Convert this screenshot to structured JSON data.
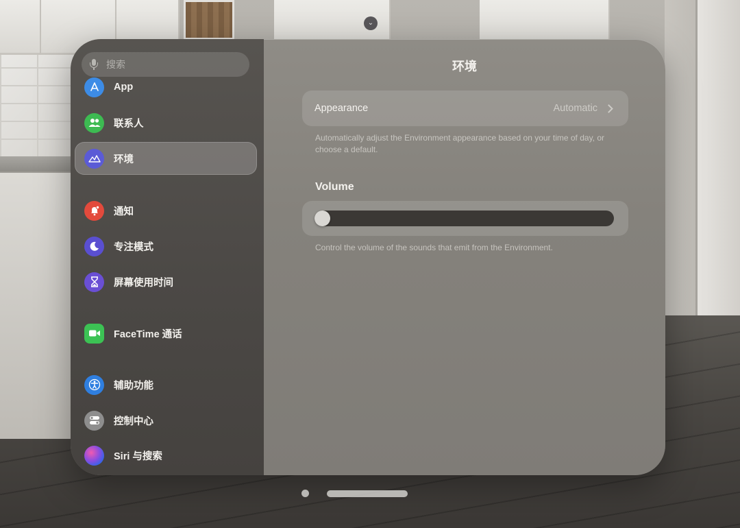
{
  "search": {
    "placeholder": "搜索",
    "icon": "mic-icon"
  },
  "sidebar": {
    "items": [
      {
        "label": "App",
        "icon": "app-store-icon",
        "color": "#3d8ce6"
      },
      {
        "label": "联系人",
        "icon": "contacts-icon",
        "color": "#3dbb52"
      },
      {
        "label": "环境",
        "icon": "environment-icon",
        "color": "#5b5bd6",
        "selected": true
      },
      {
        "label": "通知",
        "icon": "notifications-icon",
        "color": "#e34a3c"
      },
      {
        "label": "专注模式",
        "icon": "focus-moon-icon",
        "color": "#5a4fd1"
      },
      {
        "label": "屏幕使用时间",
        "icon": "hourglass-icon",
        "color": "#6a4fd4"
      },
      {
        "label": "FaceTime 通话",
        "icon": "facetime-icon",
        "color": "#3cc254"
      },
      {
        "label": "辅助功能",
        "icon": "accessibility-icon",
        "color": "#2f7fe0"
      },
      {
        "label": "控制中心",
        "icon": "control-center-icon",
        "color": "#8e8e8e"
      },
      {
        "label": "Siri 与搜索",
        "icon": "siri-icon",
        "color": "#6b4dd6"
      }
    ]
  },
  "main": {
    "title": "环境",
    "appearance": {
      "label": "Appearance",
      "value": "Automatic",
      "footnote": "Automatically adjust the Environment appearance based on your time of day, or choose a default."
    },
    "volume": {
      "heading": "Volume",
      "level": 0.0,
      "footnote": "Control the volume of the sounds that emit from the Environment."
    }
  },
  "colors": {
    "sidebar_bg": "#4b4845",
    "content_bg": "#85827c",
    "selected_bg": "rgba(255,255,255,0.22)"
  }
}
